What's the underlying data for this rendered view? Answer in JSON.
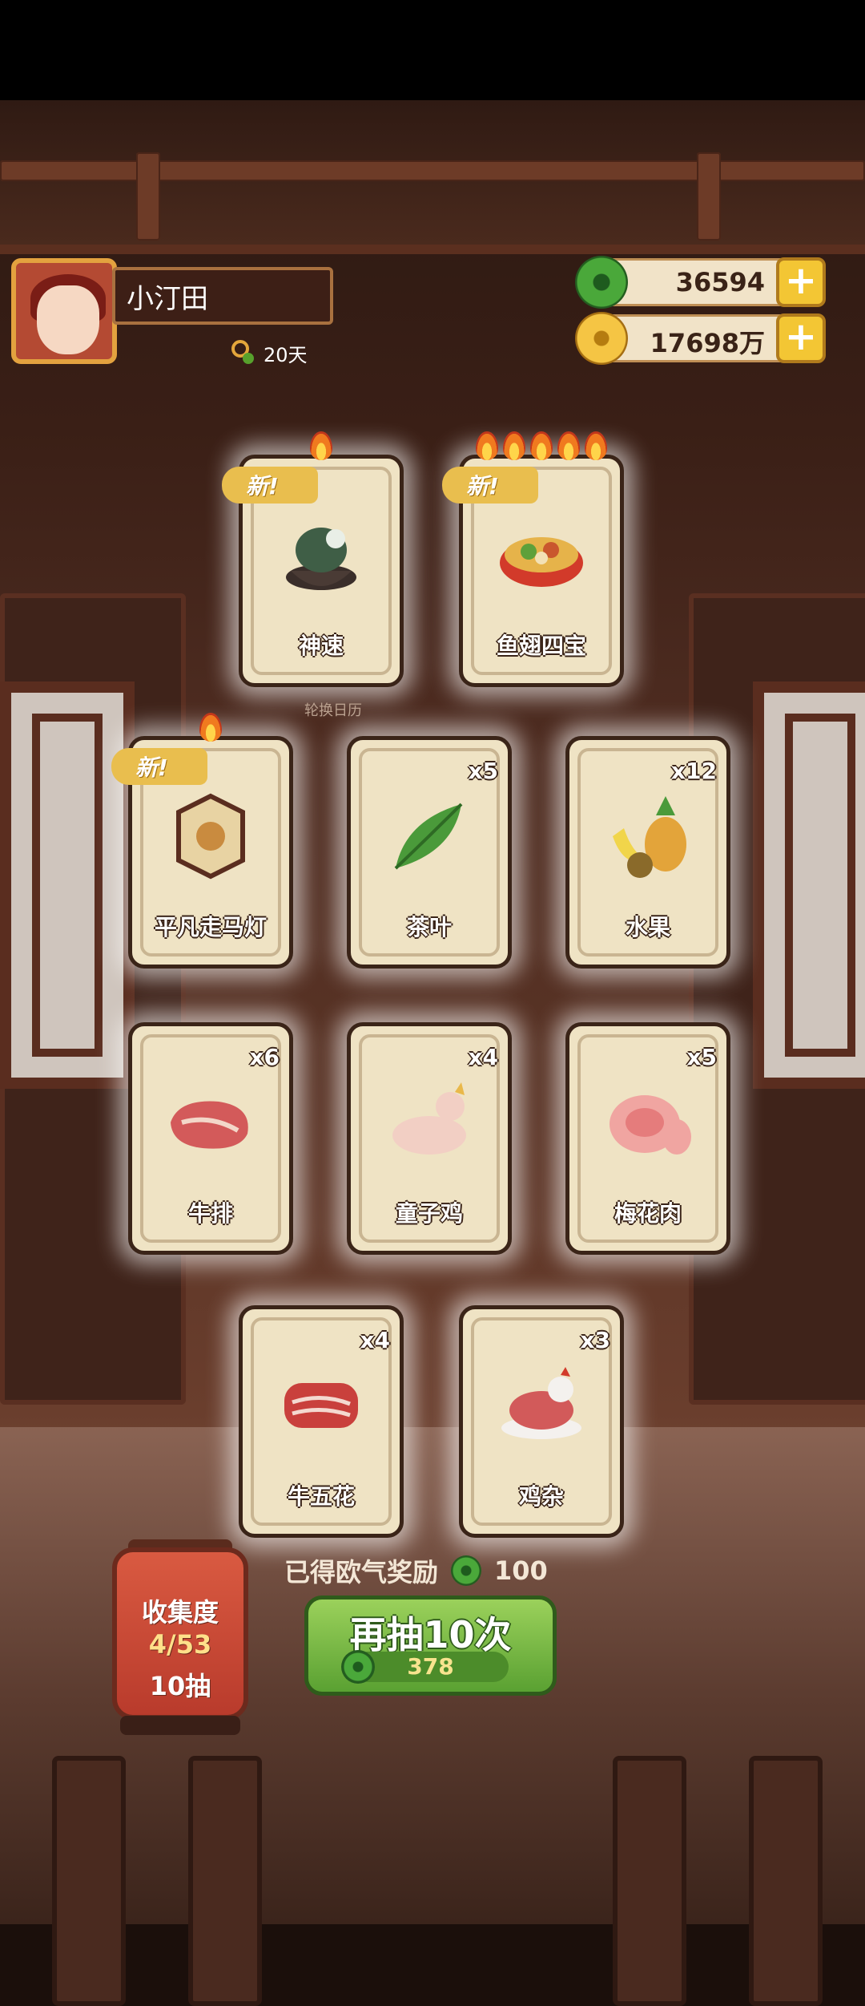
{
  "player": {
    "name": "小汀田",
    "days": "20天"
  },
  "currency": {
    "jade": "36594",
    "coins": "17698万"
  },
  "cards_top": [
    {
      "label": "神速",
      "qty": "",
      "new_label": "新!",
      "flames": 1
    },
    {
      "label": "鱼翅四宝",
      "qty": "",
      "new_label": "新!",
      "flames": 5
    }
  ],
  "calendar_caption": "轮换日历",
  "cards_row2": [
    {
      "label": "平凡走马灯",
      "qty": "",
      "new_label": "新!",
      "flames": 1
    },
    {
      "label": "茶叶",
      "qty": "x5"
    },
    {
      "label": "水果",
      "qty": "x12"
    }
  ],
  "cards_row3": [
    {
      "label": "牛排",
      "qty": "x6"
    },
    {
      "label": "童子鸡",
      "qty": "x4"
    },
    {
      "label": "梅花肉",
      "qty": "x5"
    }
  ],
  "cards_row4": [
    {
      "label": "牛五花",
      "qty": "x4"
    },
    {
      "label": "鸡杂",
      "qty": "x3"
    }
  ],
  "reward": {
    "text": "已得欧气奖励",
    "value": "100"
  },
  "draw_button": {
    "label": "再抽10次",
    "cost": "378"
  },
  "collection": {
    "title": "收集度",
    "progress": "4/53",
    "draws": "10抽"
  }
}
